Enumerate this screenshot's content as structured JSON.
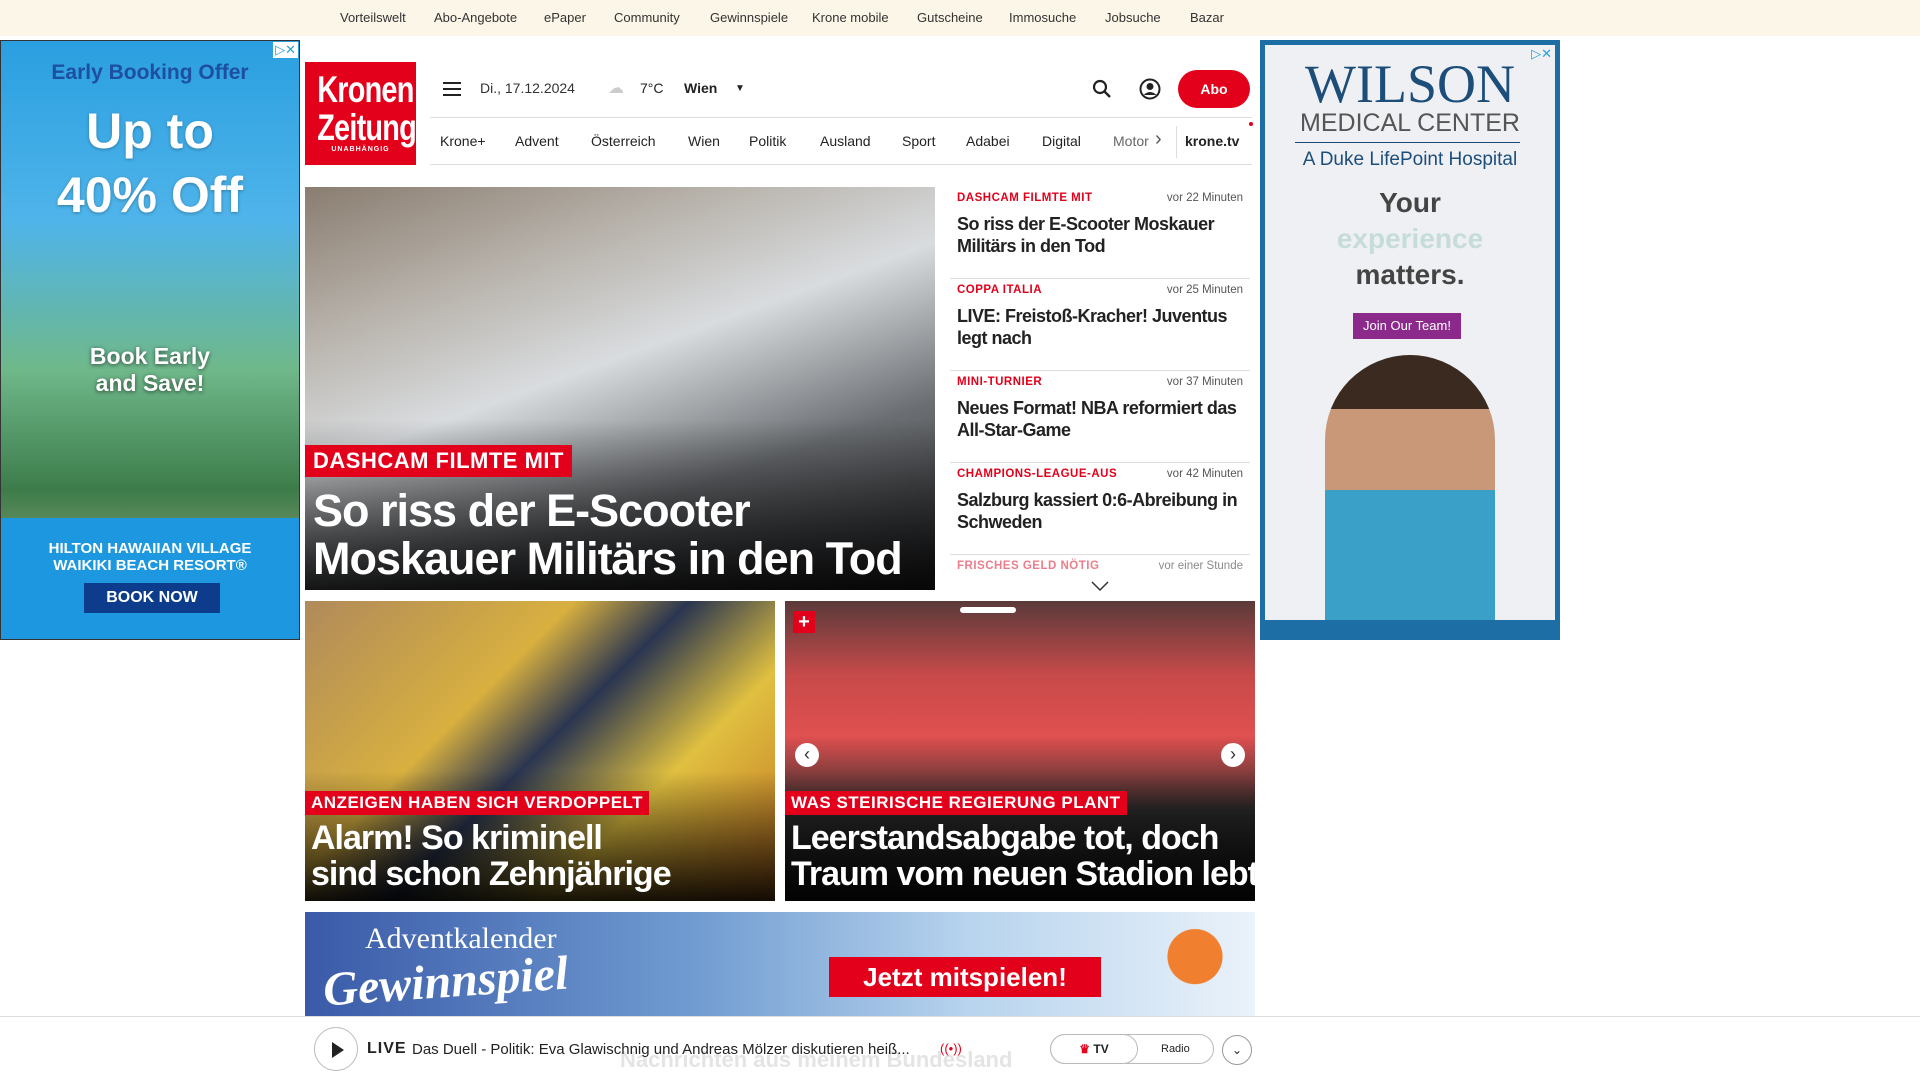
{
  "topbar": {
    "items": [
      "Vorteilswelt",
      "Abo-Angebote",
      "ePaper",
      "Community",
      "Gewinnspiele",
      "Krone mobile",
      "Gutscheine",
      "Immosuche",
      "Jobsuche",
      "Bazar"
    ]
  },
  "ad_left": {
    "line1": "Early Booking Offer",
    "line2": "Up to",
    "line3": "40% Off",
    "line4": "Book Early",
    "line5": "and Save!",
    "line6": "HILTON HAWAIIAN VILLAGE",
    "line7": "WAIKIKI BEACH RESORT®",
    "cta": "BOOK NOW",
    "adchoices": "▷✕"
  },
  "logo": {
    "l1": "Kronen",
    "l2": "Zeitung",
    "l3": "UNABHÄNGIG"
  },
  "header": {
    "date": "Di., 17.12.2024",
    "temp": "7°C",
    "city": "Wien",
    "abo": "Abo"
  },
  "nav": {
    "items": [
      "Krone+",
      "Advent",
      "Österreich",
      "Wien",
      "Politik",
      "Ausland",
      "Sport",
      "Adabei",
      "Digital",
      "Motor"
    ],
    "krone_tv": "krone.tv"
  },
  "hero": {
    "kicker": "DASHCAM FILMTE MIT",
    "line1": "So riss der E-Scooter",
    "line2": "Moskauer Militärs in den Tod"
  },
  "ticker": [
    {
      "kicker": "DASHCAM FILMTE MIT",
      "time": "vor 22 Minuten",
      "title": "So riss der E-Scooter Moskauer Militärs in den Tod"
    },
    {
      "kicker": "COPPA ITALIA",
      "time": "vor 25 Minuten",
      "title": "LIVE: Freistoß-Kracher! Juventus legt nach"
    },
    {
      "kicker": "MINI-TURNIER",
      "time": "vor 37 Minuten",
      "title": "Neues Format! NBA reformiert das All-Star-Game"
    },
    {
      "kicker": "CHAMPIONS-LEAGUE-AUS",
      "time": "vor 42 Minuten",
      "title": "Salzburg kassiert 0:6-Abreibung in Schweden"
    },
    {
      "kicker": "FRISCHES GELD NÖTIG",
      "time": "vor einer Stunde",
      "title": ""
    }
  ],
  "cards": [
    {
      "kicker": "ANZEIGEN HABEN SICH VERDOPPELT",
      "line1": "Alarm! So kriminell",
      "line2": "sind schon Zehnjährige"
    },
    {
      "kicker": "WAS STEIRISCHE REGIERUNG PLANT",
      "line1": "Leerstandsabgabe tot, doch",
      "line2": "Traum vom neuen Stadion lebt"
    }
  ],
  "advent": {
    "line1": "Adventkalender",
    "line2": "Gewinnspiel",
    "cta": "Jetzt mitspielen!"
  },
  "live": {
    "label": "LIVE",
    "text": "Das Duell - Politik: Eva Glawischnig und Andreas Mölzer diskutieren heiß...",
    "tv": "TV",
    "radio": "Radio",
    "behind": "Nachrichten aus meinem Bundesland"
  },
  "ad_right": {
    "brand1": "WILSON",
    "brand2": "MEDICAL CENTER",
    "brand3": "A Duke LifePoint Hospital",
    "l1": "Your",
    "l2": "experience",
    "l3": "matters.",
    "cta": "Join Our Team!"
  },
  "colors": {
    "brand": "#e2001a",
    "topbar": "#fcf6e8"
  }
}
